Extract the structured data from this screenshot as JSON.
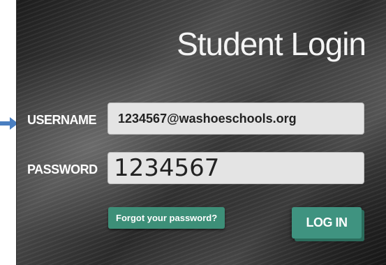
{
  "page": {
    "title": "Student Login"
  },
  "form": {
    "username_label": "USERNAME",
    "username_value": "1234567@washoeschools.org",
    "password_label": "PASSWORD",
    "password_value": "1234567"
  },
  "actions": {
    "forgot_label": "Forgot your password?",
    "login_label": "LOG IN"
  },
  "colors": {
    "accent": "#3f9380",
    "arrow": "#4a7fc1"
  },
  "icons": {
    "pointer": "arrow-right-icon"
  }
}
